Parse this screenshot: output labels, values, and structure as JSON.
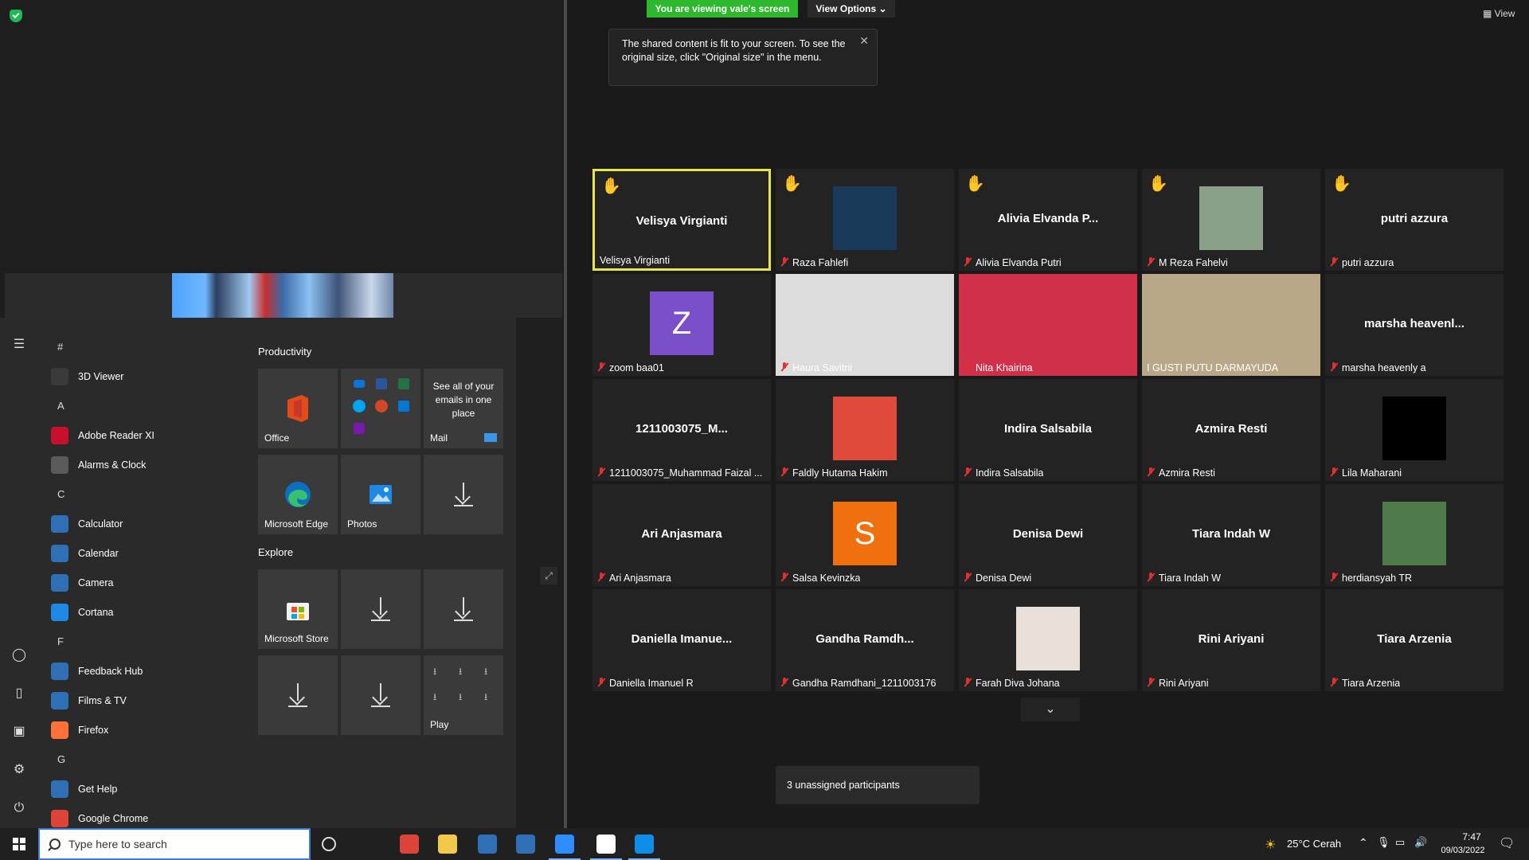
{
  "share": {
    "viewing_badge": "You are viewing vale's screen",
    "view_options_label": "View Options",
    "view_top_right": "View",
    "tooltip_text": "The shared content is fit to your screen. To see the original size, click \"Original size\" in the menu."
  },
  "start_menu": {
    "app_list": [
      {
        "type": "letter",
        "text": "#"
      },
      {
        "type": "app",
        "text": "3D Viewer",
        "icon": "cube-icon",
        "color": "#3a3a3a"
      },
      {
        "type": "letter",
        "text": "A"
      },
      {
        "type": "app",
        "text": "Adobe Reader XI",
        "icon": "adobe-icon",
        "color": "#c8102e"
      },
      {
        "type": "app",
        "text": "Alarms & Clock",
        "icon": "clock-icon",
        "color": "#5a5a5a"
      },
      {
        "type": "letter",
        "text": "C"
      },
      {
        "type": "app",
        "text": "Calculator",
        "icon": "calculator-icon",
        "color": "#2f6fb5"
      },
      {
        "type": "app",
        "text": "Calendar",
        "icon": "calendar-icon",
        "color": "#2f6fb5"
      },
      {
        "type": "app",
        "text": "Camera",
        "icon": "camera-icon",
        "color": "#2f6fb5"
      },
      {
        "type": "app",
        "text": "Cortana",
        "icon": "cortana-icon",
        "color": "#1e88e5"
      },
      {
        "type": "letter",
        "text": "F"
      },
      {
        "type": "app",
        "text": "Feedback Hub",
        "icon": "feedback-icon",
        "color": "#2f6fb5"
      },
      {
        "type": "app",
        "text": "Films & TV",
        "icon": "film-icon",
        "color": "#2f6fb5"
      },
      {
        "type": "app",
        "text": "Firefox",
        "icon": "firefox-icon",
        "color": "#ff7139"
      },
      {
        "type": "letter",
        "text": "G"
      },
      {
        "type": "app",
        "text": "Get Help",
        "icon": "help-icon",
        "color": "#2f6fb5"
      },
      {
        "type": "app",
        "text": "Google Chrome",
        "icon": "chrome-icon",
        "color": "#db4437"
      }
    ],
    "productivity_title": "Productivity",
    "explore_title": "Explore",
    "tiles": {
      "office": "Office",
      "mail": "Mail",
      "mail_text": "See all of your emails in one place",
      "edge": "Microsoft Edge",
      "photos": "Photos",
      "store": "Microsoft Store",
      "play": "Play"
    }
  },
  "participants": [
    {
      "center": "Velisya Virgianti",
      "label": "Velisya Virgianti",
      "hand": true,
      "active": true,
      "muted": false,
      "kind": "name"
    },
    {
      "center": "",
      "label": "Raza Fahlefi",
      "hand": true,
      "muted": true,
      "kind": "photo",
      "color": "#1a3a5a"
    },
    {
      "center": "Alivia Elvanda P...",
      "label": "Alivia Elvanda Putri",
      "hand": true,
      "muted": true,
      "kind": "name"
    },
    {
      "center": "",
      "label": "M Reza Fahelvi",
      "hand": true,
      "muted": true,
      "kind": "photo",
      "color": "#8aa088"
    },
    {
      "center": "putri azzura",
      "label": "putri azzura",
      "hand": true,
      "muted": true,
      "kind": "name"
    },
    {
      "center": "Z",
      "label": "zoom baa01",
      "hand": false,
      "muted": true,
      "kind": "letter",
      "color": "#7b4fc9"
    },
    {
      "center": "",
      "label": "Haura Savitrii",
      "hand": false,
      "muted": true,
      "kind": "video",
      "color": "#dcdcdc"
    },
    {
      "center": "",
      "label": "Nita Khairina",
      "hand": false,
      "muted": true,
      "kind": "video",
      "color": "#d0304a"
    },
    {
      "center": "",
      "label": "I GUSTI PUTU DARMAYUDA",
      "hand": false,
      "muted": false,
      "kind": "video",
      "color": "#b8a888"
    },
    {
      "center": "marsha heavenl...",
      "label": "marsha heavenly a",
      "hand": false,
      "muted": true,
      "kind": "name"
    },
    {
      "center": "1211003075_M...",
      "label": "1211003075_Muhammad Faizal ...",
      "hand": false,
      "muted": true,
      "kind": "name"
    },
    {
      "center": "",
      "label": "Faldly Hutama Hakim",
      "hand": false,
      "muted": true,
      "kind": "photo",
      "color": "#e04a3a"
    },
    {
      "center": "Indira Salsabila",
      "label": "Indira Salsabila",
      "hand": false,
      "muted": true,
      "kind": "name"
    },
    {
      "center": "Azmira Resti",
      "label": "Azmira Resti",
      "hand": false,
      "muted": true,
      "kind": "name"
    },
    {
      "center": "",
      "label": "Lila Maharani",
      "hand": false,
      "muted": true,
      "kind": "photo",
      "color": "#000000"
    },
    {
      "center": "Ari Anjasmara",
      "label": "Ari Anjasmara",
      "hand": false,
      "muted": true,
      "kind": "name"
    },
    {
      "center": "S",
      "label": "Salsa Kevinzka",
      "hand": false,
      "muted": true,
      "kind": "letter",
      "color": "#f07010"
    },
    {
      "center": "Denisa Dewi",
      "label": "Denisa Dewi",
      "hand": false,
      "muted": true,
      "kind": "name"
    },
    {
      "center": "Tiara Indah W",
      "label": "Tiara Indah W",
      "hand": false,
      "muted": true,
      "kind": "name"
    },
    {
      "center": "",
      "label": "herdiansyah TR",
      "hand": false,
      "muted": true,
      "kind": "photo",
      "color": "#4f7a4a"
    },
    {
      "center": "Daniella Imanue...",
      "label": "Daniella Imanuel R",
      "hand": false,
      "muted": true,
      "kind": "name"
    },
    {
      "center": "Gandha Ramdh...",
      "label": "Gandha Ramdhani_1211003176",
      "hand": false,
      "muted": true,
      "kind": "name"
    },
    {
      "center": "",
      "label": "Farah Diva Johana",
      "hand": false,
      "muted": true,
      "kind": "photo",
      "color": "#e8e0d8"
    },
    {
      "center": "Rini Ariyani",
      "label": "Rini Ariyani",
      "hand": false,
      "muted": true,
      "kind": "name"
    },
    {
      "center": "Tiara Arzenia",
      "label": "Tiara Arzenia",
      "hand": false,
      "muted": true,
      "kind": "name"
    }
  ],
  "unassigned": "3 unassigned participants",
  "taskbar": {
    "search_placeholder": "Type here to search",
    "weather": "25°C  Cerah",
    "time": "7:47",
    "date": "09/03/2022",
    "apps": [
      {
        "name": "task-view-icon",
        "color": "#202020"
      },
      {
        "name": "chrome-icon",
        "color": "#db4437"
      },
      {
        "name": "file-explorer-icon",
        "color": "#f2c94c"
      },
      {
        "name": "store-icon",
        "color": "#2f6fb5"
      },
      {
        "name": "mail-icon",
        "color": "#2f6fb5"
      },
      {
        "name": "zoom-icon",
        "color": "#2d8cff"
      },
      {
        "name": "document-icon",
        "color": "#ffffff"
      },
      {
        "name": "teamviewer-icon",
        "color": "#0e8ee9"
      }
    ]
  }
}
